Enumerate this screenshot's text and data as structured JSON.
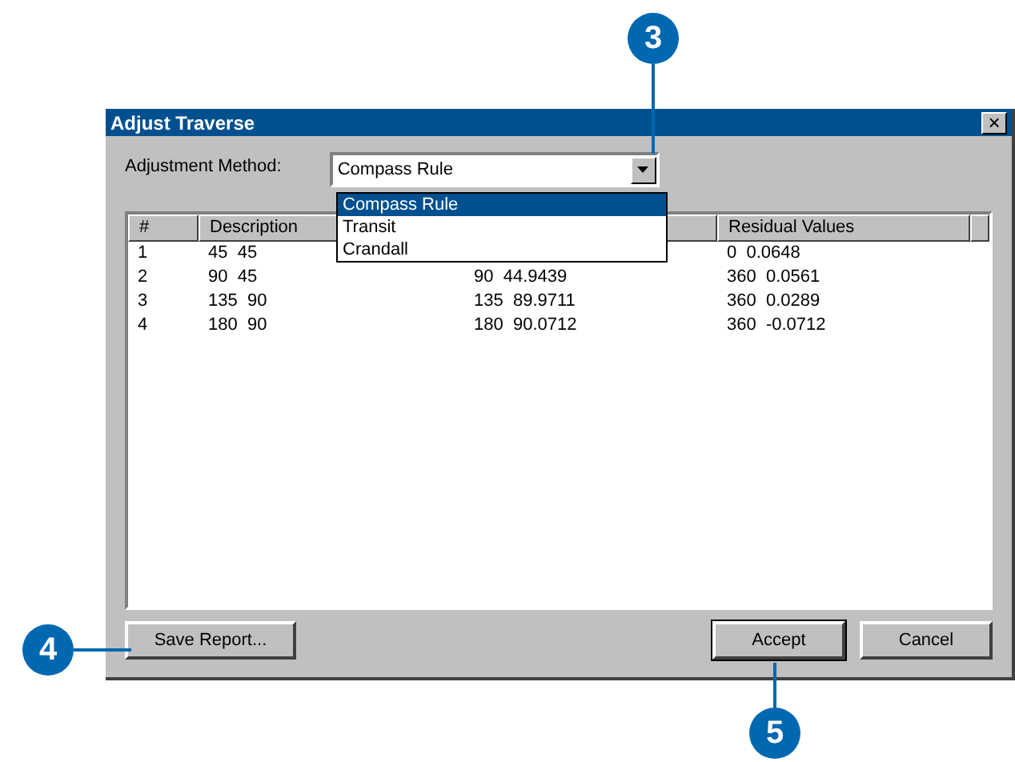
{
  "window": {
    "title": "Adjust Traverse",
    "close": "×"
  },
  "method": {
    "label": "Adjustment Method:",
    "value": "Compass Rule",
    "expanded": true,
    "options": [
      {
        "label": "Compass Rule",
        "selected": true
      },
      {
        "label": "Transit",
        "selected": false
      },
      {
        "label": "Crandall",
        "selected": false
      }
    ]
  },
  "table": {
    "columns": [
      "#",
      "Description",
      "",
      "Residual Values"
    ],
    "rows": [
      [
        "1",
        "45  45",
        "",
        "0  0.0648"
      ],
      [
        "2",
        "90  45",
        "90  44.9439",
        "360  0.0561"
      ],
      [
        "3",
        "135  90",
        "135  89.9711",
        "360  0.0289"
      ],
      [
        "4",
        "180  90",
        "180  90.0712",
        "360  -0.0712"
      ]
    ]
  },
  "buttons": {
    "save": "Save Report...",
    "accept": "Accept",
    "cancel": "Cancel"
  },
  "callouts": [
    {
      "number": "3"
    },
    {
      "number": "4"
    },
    {
      "number": "5"
    }
  ]
}
